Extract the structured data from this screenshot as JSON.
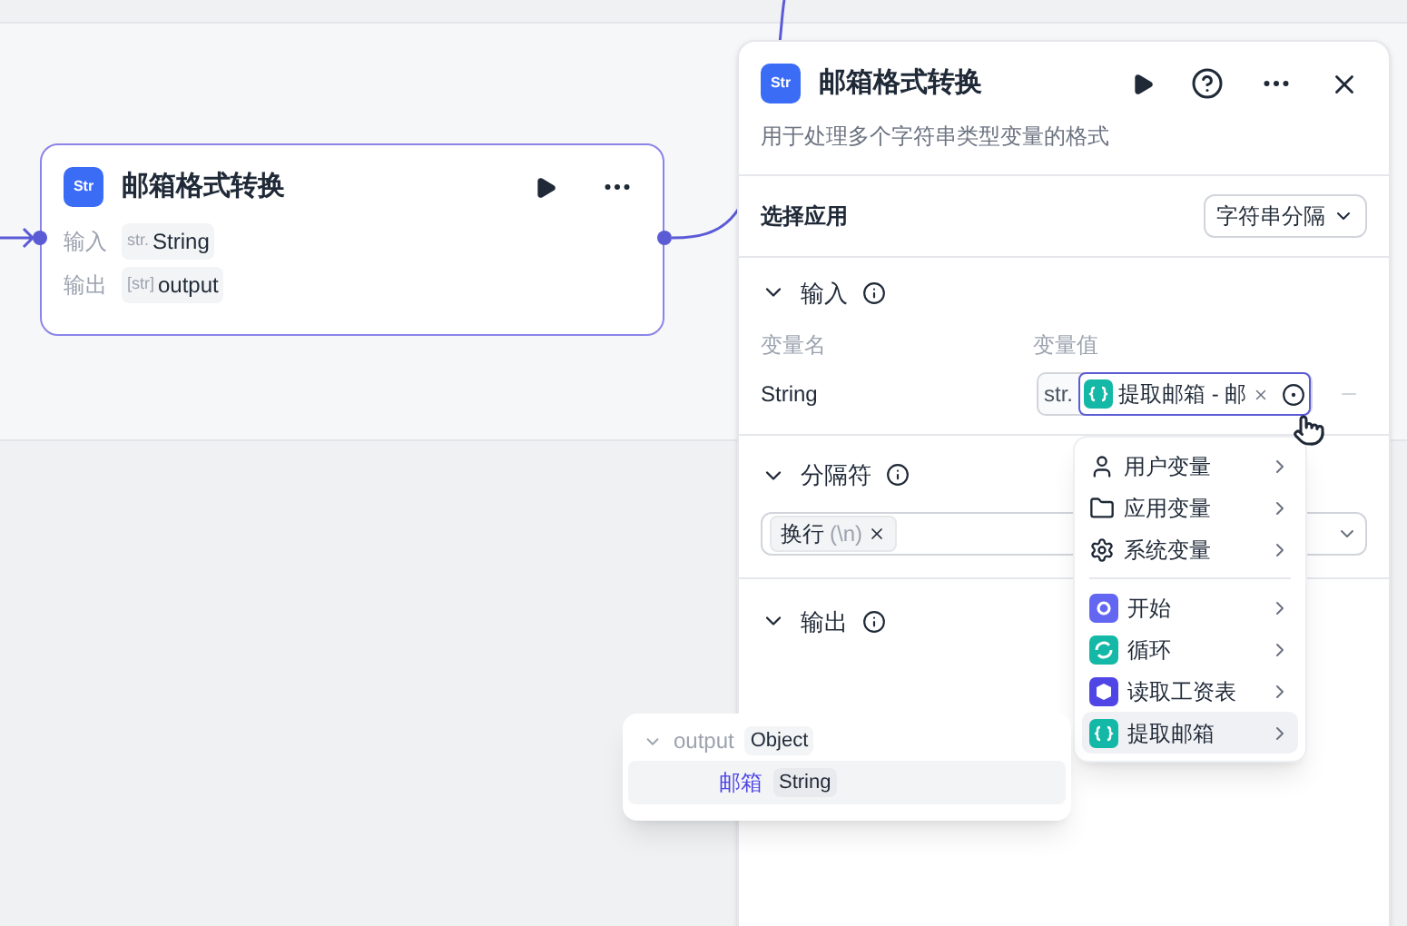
{
  "node": {
    "icon_text": "Str",
    "title": "邮箱格式转换",
    "rows": [
      {
        "label": "输入",
        "type": "str.",
        "value": "String"
      },
      {
        "label": "输出",
        "type": "[str]",
        "value": "output"
      }
    ]
  },
  "panel": {
    "icon_text": "Str",
    "title": "邮箱格式转换",
    "description": "用于处理多个字符串类型变量的格式",
    "app_select": {
      "label": "选择应用",
      "value": "字符串分隔"
    },
    "input": {
      "title": "输入",
      "expanded": true,
      "columns": [
        "变量名",
        "变量值"
      ],
      "variables": [
        {
          "name": "String",
          "type": "str.",
          "value": "提取邮箱 - 邮"
        }
      ]
    },
    "separator": {
      "title": "分隔符",
      "expanded": true,
      "tags": [
        {
          "label": "换行",
          "hint": "(\\n)"
        }
      ]
    },
    "output": {
      "title": "输出",
      "expanded": true
    }
  },
  "menu": {
    "items": [
      {
        "kind": "user",
        "label": "用户变量",
        "selected": false
      },
      {
        "kind": "folder",
        "label": "应用变量",
        "selected": false
      },
      {
        "kind": "gear",
        "label": "系统变量",
        "selected": false
      },
      {
        "kind": "start",
        "label": "开始",
        "color": "#6366f1",
        "selected": false
      },
      {
        "kind": "loop",
        "label": "循环",
        "color": "#14b8a6",
        "selected": false
      },
      {
        "kind": "box",
        "label": "读取工资表",
        "color": "#4f46e5",
        "selected": false
      },
      {
        "kind": "code",
        "label": "提取邮箱",
        "color": "#14b8a6",
        "selected": true
      }
    ]
  },
  "output_popover": {
    "name": "output",
    "type": "Object",
    "expanded": true,
    "children": [
      {
        "name": "邮箱",
        "type": "String",
        "selected": true
      }
    ]
  }
}
